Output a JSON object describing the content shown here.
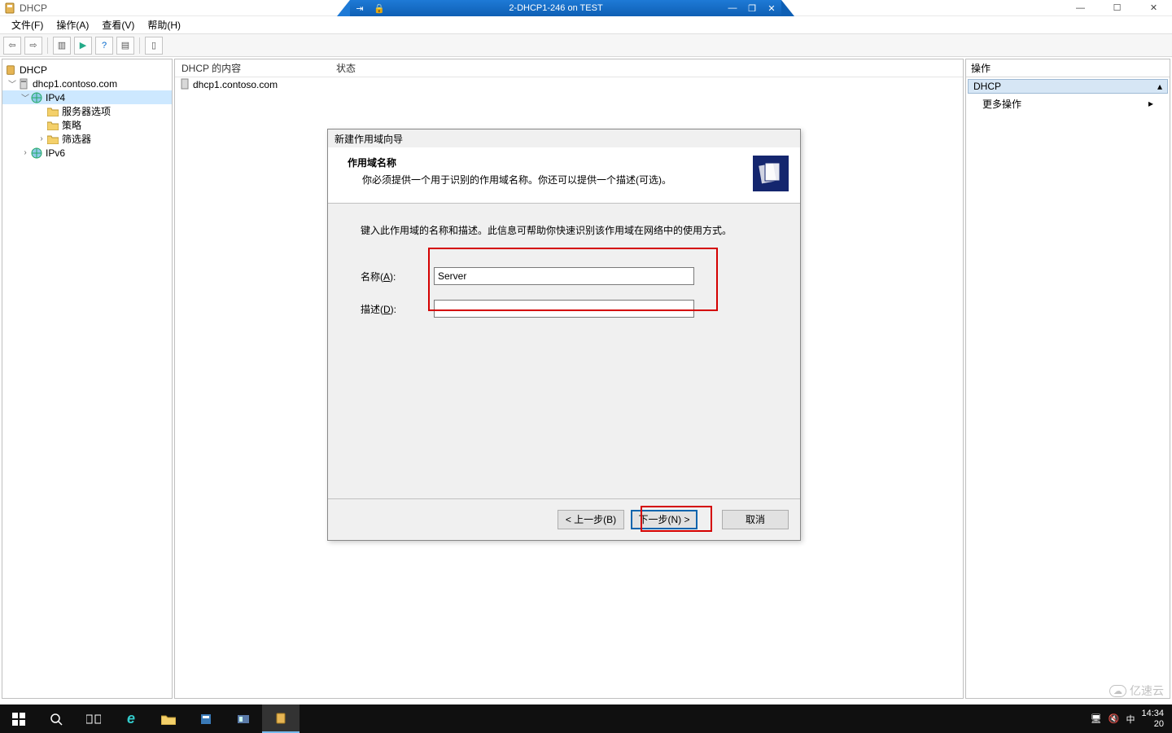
{
  "window": {
    "title": "DHCP",
    "vm_title": "2-DHCP1-246 on TEST"
  },
  "menu": {
    "file": "文件(F)",
    "action": "操作(A)",
    "view": "查看(V)",
    "help": "帮助(H)"
  },
  "tree": {
    "root": "DHCP",
    "server": "dhcp1.contoso.com",
    "ipv4": "IPv4",
    "server_options": "服务器选项",
    "policies": "策略",
    "filters": "筛选器",
    "ipv6": "IPv6"
  },
  "center": {
    "col_contents": "DHCP 的内容",
    "col_status": "状态",
    "row_server": "dhcp1.contoso.com"
  },
  "actions": {
    "title": "操作",
    "group": "DHCP",
    "more": "更多操作"
  },
  "wizard": {
    "title": "新建作用域向导",
    "heading": "作用域名称",
    "subheading": "你必须提供一个用于识别的作用域名称。你还可以提供一个描述(可选)。",
    "intro": "键入此作用域的名称和描述。此信息可帮助你快速识别该作用域在网络中的使用方式。",
    "name_label_pre": "名称(",
    "name_label_u": "A",
    "name_label_post": "):",
    "desc_label_pre": "描述(",
    "desc_label_u": "D",
    "desc_label_post": "):",
    "name_value": "Server",
    "desc_value": "",
    "btn_back": "< 上一步(B)",
    "btn_next": "下一步(N) >",
    "btn_cancel": "取消"
  },
  "taskbar": {
    "time": "14:34",
    "date_suffix": "20",
    "ime": "中",
    "tray_net": "🖥",
    "tray_vol": "🔇"
  },
  "watermark": "亿速云"
}
